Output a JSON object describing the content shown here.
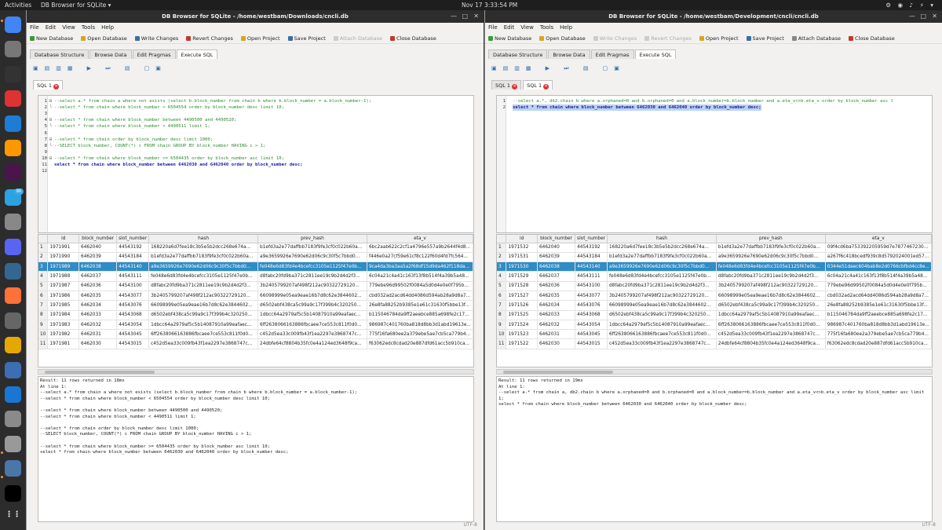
{
  "topbar": {
    "activities": "Activities",
    "app_name": "DB Browser for SQLite ▾",
    "clock": "Nov 17  3:33:54 PM",
    "tray": "⚙ ◉ ♪ ⚡ ▾"
  },
  "dock": {
    "icons": [
      "chrome-icon",
      "files-icon",
      "terminal-icon",
      "system-monitor-icon",
      "vscode-icon",
      "sublime-icon",
      "slack-icon",
      "telegram-icon",
      "settings-icon",
      "discord-icon",
      "pgadmin-icon",
      "firefox-icon",
      "calculator-icon",
      "rhythmbox-icon",
      "text-editor-icon",
      "libreoffice-icon",
      "image-viewer-icon",
      "search-icon",
      "sqlite-browser-icon",
      "intellij-icon",
      "show-apps-icon"
    ],
    "telegram_badge": "86"
  },
  "left_window": {
    "title": "DB Browser for SQLite - /home/westbam/Downloads/cncli.db",
    "menu": [
      "File",
      "Edit",
      "View",
      "Tools",
      "Help"
    ],
    "toolbar": [
      {
        "label": "New Database",
        "enabled": true
      },
      {
        "label": "Open Database",
        "enabled": true
      },
      {
        "label": "Write Changes",
        "enabled": true
      },
      {
        "label": "Revert Changes",
        "enabled": true
      },
      {
        "label": "Open Project",
        "enabled": true
      },
      {
        "label": "Save Project",
        "enabled": true
      },
      {
        "label": "Attach Database",
        "enabled": false
      },
      {
        "label": "Close Database",
        "enabled": true
      }
    ],
    "tabs": [
      "Database Structure",
      "Browse Data",
      "Edit Pragmas",
      "Execute SQL"
    ],
    "active_tab": "Execute SQL",
    "sql_tabs": [
      "SQL 1"
    ],
    "editor_lines": [
      {
        "n": "1",
        "text": "--select a.* from chain a where not exists (select b.block_number from chain b where b.block_number = a.block_number-1);",
        "kind": "cmt",
        "fold": "⊟"
      },
      {
        "n": "2",
        "text": "--select * from chain where block_number < 6504554 order by block_number desc limit 10;",
        "kind": "cmt",
        "fold": "└"
      },
      {
        "n": "3",
        "text": "",
        "kind": "cmt",
        "fold": ""
      },
      {
        "n": "4",
        "text": "--select * from chain where block_number between 4490500 and 4490520;",
        "kind": "cmt",
        "fold": "⊟"
      },
      {
        "n": "5",
        "text": "--select * from chain where block_number < 4490511 limit 1;",
        "kind": "cmt",
        "fold": "└"
      },
      {
        "n": "6",
        "text": "",
        "kind": "cmt",
        "fold": ""
      },
      {
        "n": "7",
        "text": "--select * from chain order by block_number desc limit 1000;",
        "kind": "cmt",
        "fold": "⊟"
      },
      {
        "n": "8",
        "text": "--SELECT block_number, COUNT(*) c FROM chain GROUP BY block_number HAVING c > 1;",
        "kind": "cmt",
        "fold": "└"
      },
      {
        "n": "9",
        "text": "",
        "kind": "cmt",
        "fold": ""
      },
      {
        "n": "10",
        "text": "--select * from chain where block_number >= 6504435 order by block_number asc limit 10;",
        "kind": "cmt",
        "fold": "⊟"
      },
      {
        "n": "11",
        "text": "select * from chain where block_number between 6462030 and 6462040 order by block_number desc;",
        "kind": "kw",
        "fold": ""
      },
      {
        "n": "12",
        "text": "",
        "kind": "cmt",
        "fold": ""
      }
    ],
    "columns": [
      "",
      "id",
      "block_number",
      "slot_number",
      "hash",
      "prev_hash",
      "eta_v"
    ],
    "rows": [
      [
        "1",
        "1971991",
        "6462040",
        "44543192",
        "168220a6d7fee18c3b5e5b2dcc268e674a...",
        "b1efd3a2e77daffbb7183f9fe3cf0c022b60a...",
        "6bc2aab622c2cf1a4796e557a9b2644f4d8..."
      ],
      [
        "2",
        "1971990",
        "6462039",
        "44543184",
        "b1efd3a2e77daffbb7183f9fe3cf0c022b60a...",
        "a9e3659926e7690e62d06c9c30f5c7bbd0...",
        "f446e0a27cf59e61cf8c122f60d4fd7fc564..."
      ],
      [
        "3",
        "1971989",
        "6462038",
        "44543140",
        "a9e3659926e7690e62d06c9c30f5c7bbd0...",
        "fe048e6d83fd4e4bcefcc3105e1125f47e0b...",
        "9ca4da3ba3aa5a2f68df15d9da462f118da..."
      ],
      [
        "4",
        "1971988",
        "6462037",
        "44543111",
        "fe048e6d83fd4e4bcefcc3105e1125f47e0b...",
        "d8fabc20fd9ba371c2811ee19c9b2d4d2f3...",
        "6c04a21c4a41c163f13f8b514f4a39b5a48..."
      ],
      [
        "5",
        "1971987",
        "6462036",
        "44543100",
        "d8fabc20fd9ba371c2811ee19c9b2d4d2f3...",
        "3b2405799207af498f212ac90322729120...",
        "779ebe96d99502f0084a5d0d4e0e0f795b..."
      ],
      [
        "6",
        "1971986",
        "6462035",
        "44543077",
        "3b2405799207af498f212ac90322729120...",
        "66098999e05ea9eae16b7d8c62e3844602...",
        "cbd032ad2acd64dd4086d594ab28a9d8a7..."
      ],
      [
        "7",
        "1971985",
        "6462034",
        "44543076",
        "66098999e05ea9eae16b7d8c62e3844602...",
        "d6502ebf438ca5c99a9c17f399b4c320250...",
        "26e8fa88252b9385e1e61c31630f5bbe13f..."
      ],
      [
        "8",
        "1971984",
        "6462033",
        "44543068",
        "d6502ebf438ca5c99a9c17f399b4c320250...",
        "1dbcc64a2979af5c5b14087910a99eafaec...",
        "b115046784da9ff2aeebce885a698fe2c17..."
      ],
      [
        "9",
        "1971983",
        "6462032",
        "44543054",
        "1dbcc64a2979af5c5b14087910a99eafaec...",
        "6ff2638066163886fbcaee7ce553c811f0d0...",
        "986987c401760ba818d8bb3d1abd19613e..."
      ],
      [
        "10",
        "1971982",
        "6462031",
        "44543045",
        "6ff2638066163886fbcaee7ce553c811f0d0...",
        "c452d5ea33c009fb43f1ea2297e3868747c...",
        "775f16fa680ee2a379ebe5ae7cb5ca779b4..."
      ],
      [
        "11",
        "1971981",
        "6462030",
        "44543015",
        "c452d5ea33c009fb43f1ea2297e3868747c...",
        "24dbfe64cf8804b35fc0e4a124ed3648f9ca...",
        "f63062edc8cdad20e887dfd61acc5b910ca..."
      ]
    ],
    "highlight_row": 2,
    "message": "Result: 11 rows returned in 18ms\nAt line 1:\n--select a.* from chain a where not exists (select b.block_number from chain b where b.block_number = a.block_number-1);\n--select * from chain where block_number < 6504554 order by block_number desc limit 10;\n\n--select * from chain where block_number between 4490500 and 4490520;\n--select * from chain where block_number < 4490511 limit 1;\n\n--select * from chain order by block_number desc limit 1000;\n--SELECT block_number, COUNT(*) c FROM chain GROUP BY block_number HAVING c > 1;\n\n--select * from chain where block_number >= 6504435 order by block_number asc limit 10;\nselect * from chain where block_number between 6462030 and 6462040 order by block_number desc;",
    "status": "UTF-8"
  },
  "right_window": {
    "title": "DB Browser for SQLite - /home/westbam/Development/cncli/cncli.db",
    "menu": [
      "File",
      "Edit",
      "View",
      "Tools",
      "Help"
    ],
    "toolbar": [
      {
        "label": "New Database",
        "enabled": true
      },
      {
        "label": "Open Database",
        "enabled": true
      },
      {
        "label": "Write Changes",
        "enabled": false
      },
      {
        "label": "Revert Changes",
        "enabled": false
      },
      {
        "label": "Open Project",
        "enabled": true
      },
      {
        "label": "Save Project",
        "enabled": true
      },
      {
        "label": "Attach Database",
        "enabled": true
      },
      {
        "label": "Close Database",
        "enabled": true
      }
    ],
    "tabs": [
      "Database Structure",
      "Browse Data",
      "Edit Pragmas",
      "Execute SQL"
    ],
    "active_tab": "Execute SQL",
    "sql_tabs": [
      "SQL 1",
      "SQL 1"
    ],
    "editor_lines": [
      {
        "n": "1",
        "text": "--select a.*, db2.chain b where a.orphaned=0 and b.orphaned=0 and a.block_number=b.block_number and a.eta_v<>b.eta_v order by block_number asc l",
        "kind": "cmt",
        "fold": ""
      },
      {
        "n": "2",
        "text": "select * from chain where block_number between 6462030 and 6462040 order by block_number desc;",
        "kind": "sel",
        "fold": ""
      }
    ],
    "columns": [
      "",
      "id",
      "block_number",
      "slot_number",
      "hash",
      "prev_hash",
      "eta_v"
    ],
    "rows": [
      [
        "1",
        "1971532",
        "6462040",
        "44543192",
        "168220a6d7fee18c3b5e5b2dcc268e674a...",
        "b1efd3a2e77daffbb7183f9fe3cf0c022b60a...",
        "09f4cd6ba753392205959d7e7877467230..."
      ],
      [
        "2",
        "1971531",
        "6462039",
        "44543184",
        "b1efd3a2e77daffbb7183f9fe3cf0c022b60a...",
        "a9e3659926e7690e62d06c9c30f5c7bbd0...",
        "a267f6c418bcedf939c8d5792024001ed57..."
      ],
      [
        "3",
        "1971530",
        "6462038",
        "44543140",
        "a9e3659926e7690e62d06c9c30f5c7bbd0...",
        "fe048e6d83fd4e4bcefcc3105e1125f47e0b...",
        "0344e51daec604bab8e2d0766cbfbd4cc8e..."
      ],
      [
        "4",
        "1971529",
        "6462037",
        "44543111",
        "fe048e6d83fd4e4bcefcc3105e1125f47e0b...",
        "d8fabc20fd9ba371c2811ee19c9b2d4d2f3...",
        "6c04a21c4a41c163f13f8b514f4a39b5a48..."
      ],
      [
        "5",
        "1971528",
        "6462036",
        "44543100",
        "d8fabc20fd9ba371c2811ee19c9b2d4d2f3...",
        "3b2405799207af498f212ac90322729120...",
        "779ebe96d99502f0084a5d0d4e0e0f795b..."
      ],
      [
        "6",
        "1971527",
        "6462035",
        "44543077",
        "3b2405799207af498f212ac90322729120...",
        "66098999e05ea9eae16b7d8c62e3844602...",
        "cbd032ad2acd64dd4086d594ab28a9d8a7..."
      ],
      [
        "7",
        "1971526",
        "6462034",
        "44543076",
        "66098999e05ea9eae16b7d8c62e3844602...",
        "d6502ebf438ca5c99a9c17f399b4c320250...",
        "26e8fa88252b9385e1e61c31630f5bbe13f..."
      ],
      [
        "8",
        "1971525",
        "6462033",
        "44543068",
        "d6502ebf438ca5c99a9c17f399b4c320250...",
        "1dbcc64a2979af5c5b14087910a99eafaec...",
        "b115046784da9ff2aeebce885a698fe2c17..."
      ],
      [
        "9",
        "1971524",
        "6462032",
        "44543054",
        "1dbcc64a2979af5c5b14087910a99eafaec...",
        "6ff2638066163886fbcaee7ce553c811f0d0...",
        "986987c401760ba818d8bb3d1abd19613e..."
      ],
      [
        "10",
        "1971523",
        "6462031",
        "44543045",
        "6ff2638066163886fbcaee7ce553c811f0d0...",
        "c452d5ea33c009fb43f1ea2297e3868747c...",
        "775f16fa680ee2a379ebe5ae7cb5ca779b4..."
      ],
      [
        "11",
        "1971522",
        "6462030",
        "44543015",
        "c452d5ea33c009fb43f1ea2297e3868747c...",
        "24dbfe64cf8804b35fc0e4a124ed3648f9ca...",
        "f63062edc8cdad20e887dfd61acc5b910ca..."
      ]
    ],
    "highlight_row": 2,
    "message": "Result: 11 rows returned in 19ms\nAt line 1:\n--select a.* from chain a, db2.chain b where a.orphaned=0 and b.orphaned=0 and a.block_number=b.block_number and a.eta_v<>b.eta_v order by block_number asc limit\n1;\nselect * from chain where block_number between 6462030 and 6462040 order by block_number desc;",
    "status": "UTF-8"
  },
  "colors": {
    "highlight": "#308cc6",
    "comment": "#2e8b2e",
    "keyword": "#1a1aa6",
    "titlebar": "#2d2d2d"
  }
}
